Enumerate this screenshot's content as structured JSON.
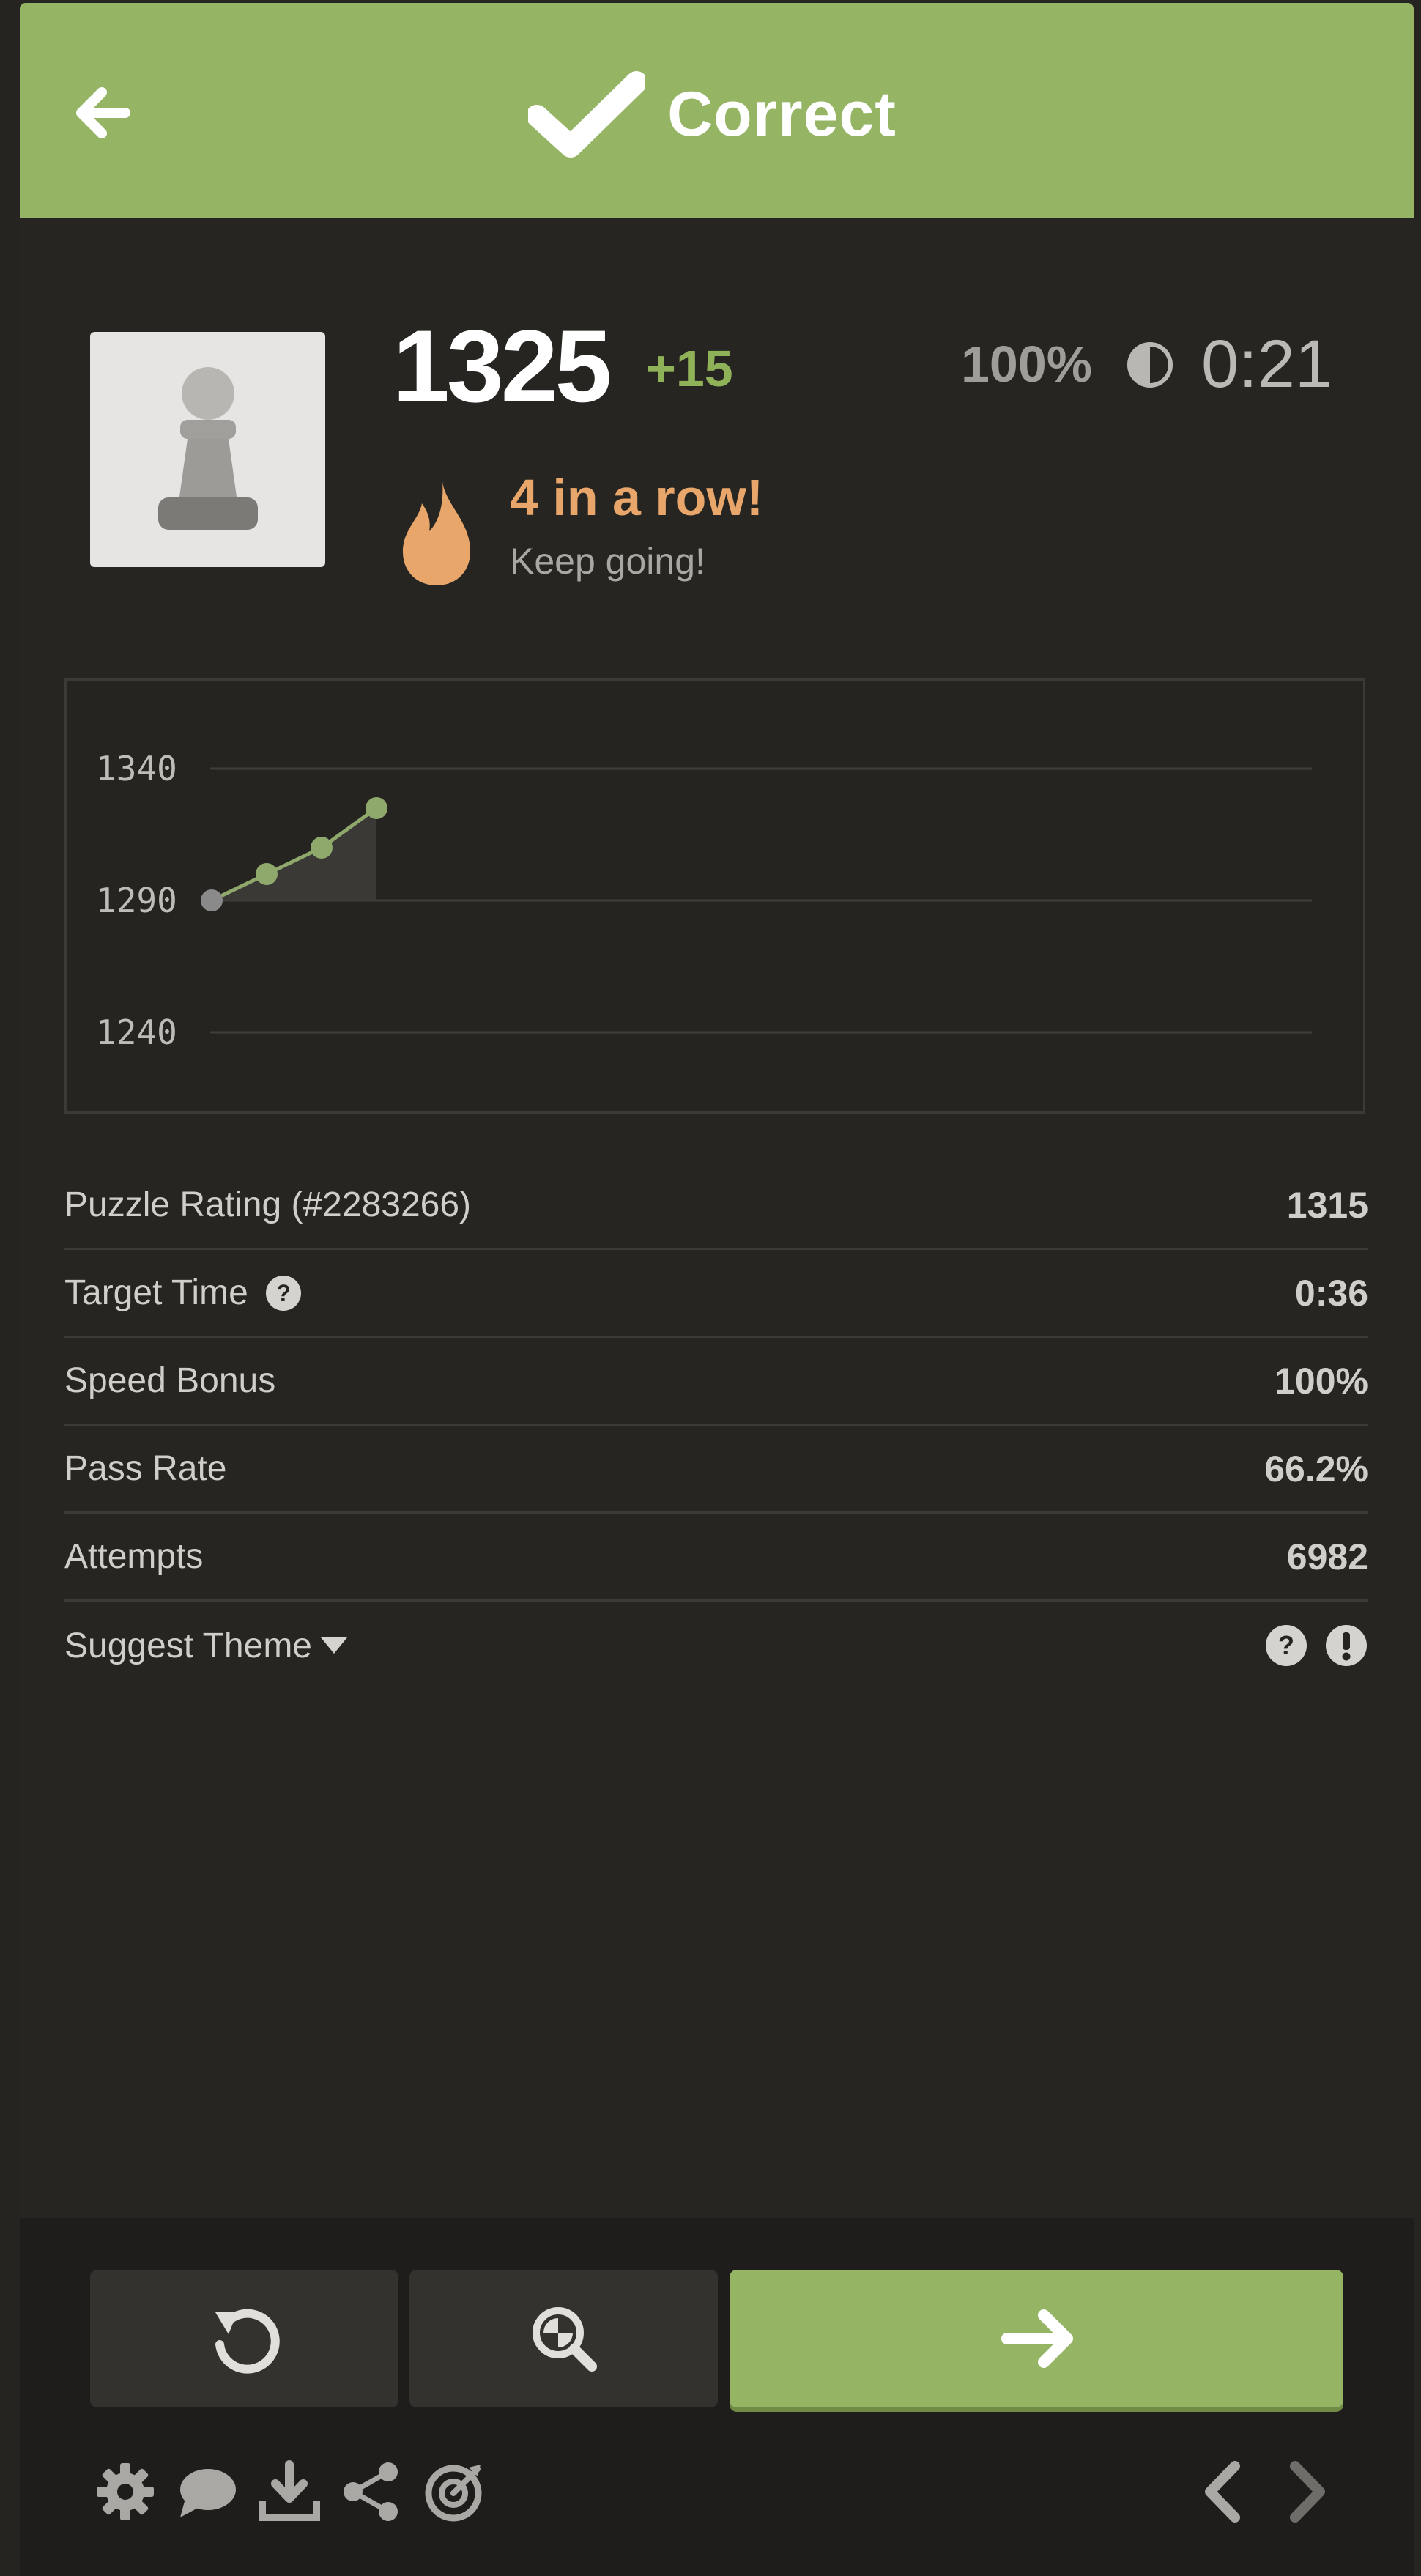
{
  "header": {
    "title": "Correct",
    "color": "#95b565"
  },
  "result": {
    "rating": "1325",
    "rating_diff": "+15",
    "speed_percent": "100%",
    "time": "0:21",
    "streak_title": "4 in a row!",
    "streak_subtitle": "Keep going!"
  },
  "chart_data": {
    "type": "line",
    "x": [
      1,
      2,
      3,
      4
    ],
    "y": [
      1290,
      1300,
      1310,
      1325
    ],
    "yticks": [
      "1340",
      "1290",
      "1240"
    ],
    "ylim": [
      1240,
      1340
    ],
    "grid": true,
    "colors": {
      "line": "#8fa86c",
      "point_first": "#8a8a8a",
      "point": "#8fa86c",
      "fill": "#3a3936"
    }
  },
  "stats": [
    {
      "label": "Puzzle Rating (#2283266)",
      "value": "1315"
    },
    {
      "label": "Target Time",
      "value": "0:36",
      "help_icon": "question-circle-icon"
    },
    {
      "label": "Speed Bonus",
      "value": "100%"
    },
    {
      "label": "Pass Rate",
      "value": "66.2%"
    },
    {
      "label": "Attempts",
      "value": "6982"
    }
  ],
  "suggest_theme": {
    "label": "Suggest Theme",
    "icons": [
      "question-circle-icon",
      "exclamation-circle-icon"
    ]
  },
  "actions": [
    "retry-icon",
    "analysis-icon",
    "next-arrow-icon"
  ],
  "toolbar": [
    "gear-icon",
    "chat-icon",
    "download-icon",
    "share-icon",
    "target-icon",
    "chevron-left-icon",
    "chevron-right-icon"
  ]
}
